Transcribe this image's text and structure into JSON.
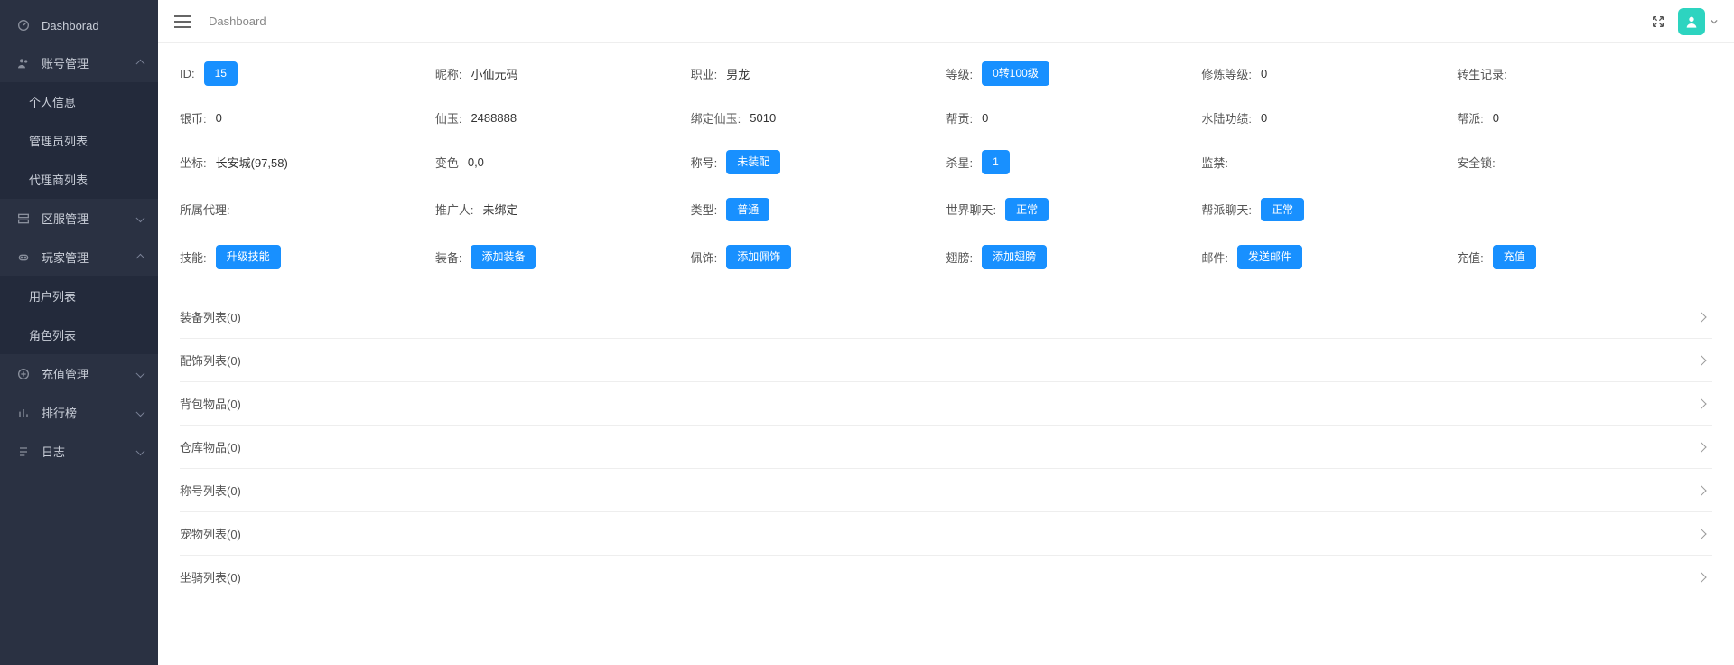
{
  "sidebar": {
    "items": [
      {
        "label": "Dashborad",
        "icon": "dashboard-icon",
        "submenu": null
      },
      {
        "label": "账号管理",
        "icon": "users-icon",
        "open": true,
        "submenu": [
          "个人信息",
          "管理员列表",
          "代理商列表"
        ]
      },
      {
        "label": "区服管理",
        "icon": "server-icon",
        "open": false,
        "submenu": []
      },
      {
        "label": "玩家管理",
        "icon": "player-icon",
        "open": true,
        "submenu": [
          "用户列表",
          "角色列表"
        ]
      },
      {
        "label": "充值管理",
        "icon": "recharge-icon",
        "open": false,
        "submenu": []
      },
      {
        "label": "排行榜",
        "icon": "rank-icon",
        "open": false,
        "submenu": []
      },
      {
        "label": "日志",
        "icon": "log-icon",
        "open": false,
        "submenu": []
      }
    ]
  },
  "breadcrumb": "Dashboard",
  "details": {
    "row1": {
      "id_label": "ID:",
      "id_value": "15",
      "nick_label": "昵称:",
      "nick_value": "小仙元码",
      "job_label": "职业:",
      "job_value": "男龙",
      "level_label": "等级:",
      "level_value": "0转100级",
      "train_label": "修炼等级:",
      "train_value": "0",
      "rebirth_label": "转生记录:"
    },
    "row2": {
      "silver_label": "银币:",
      "silver_value": "0",
      "jade_label": "仙玉:",
      "jade_value": "2488888",
      "bindjade_label": "绑定仙玉:",
      "bindjade_value": "5010",
      "contrib_label": "帮贡:",
      "contrib_value": "0",
      "merit_label": "水陆功绩:",
      "merit_value": "0",
      "guild_label": "帮派:",
      "guild_value": "0"
    },
    "row3": {
      "coord_label": "坐标:",
      "coord_value": "长安城(97,58)",
      "color_label": "变色",
      "color_value": "0,0",
      "title_label": "称号:",
      "title_btn": "未装配",
      "kill_label": "杀星:",
      "kill_value": "1",
      "ban_label": "监禁:",
      "lock_label": "安全锁:"
    },
    "row4": {
      "agent_label": "所属代理:",
      "promoter_label": "推广人:",
      "promoter_value": "未绑定",
      "type_label": "类型:",
      "type_btn": "普通",
      "worldchat_label": "世界聊天:",
      "worldchat_btn": "正常",
      "guildchat_label": "帮派聊天:",
      "guildchat_btn": "正常"
    },
    "row5": {
      "skill_label": "技能:",
      "skill_btn": "升级技能",
      "equip_label": "装备:",
      "equip_btn": "添加装备",
      "acc_label": "佩饰:",
      "acc_btn": "添加佩饰",
      "wing_label": "翅膀:",
      "wing_btn": "添加翅膀",
      "mail_label": "邮件:",
      "mail_btn": "发送邮件",
      "recharge_label": "充值:",
      "recharge_btn": "充值"
    }
  },
  "accordion": [
    "装备列表(0)",
    "配饰列表(0)",
    "背包物品(0)",
    "仓库物品(0)",
    "称号列表(0)",
    "宠物列表(0)",
    "坐骑列表(0)"
  ]
}
